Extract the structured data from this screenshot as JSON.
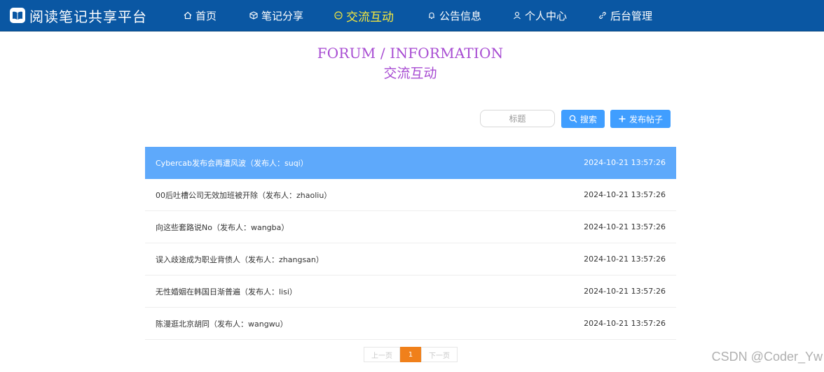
{
  "brand": {
    "title": "阅读笔记共享平台",
    "icon": "book-icon"
  },
  "nav": {
    "home": {
      "label": "首页",
      "icon": "home-icon"
    },
    "notes": {
      "label": "笔记分享",
      "icon": "cube-icon"
    },
    "forum": {
      "label": "交流互动",
      "icon": "chat-icon"
    },
    "notice": {
      "label": "公告信息",
      "icon": "bell-icon"
    },
    "profile": {
      "label": "个人中心",
      "icon": "user-icon"
    },
    "admin": {
      "label": "后台管理",
      "icon": "link-icon"
    }
  },
  "page": {
    "title_en": "FORUM / INFORMATION",
    "title_cn": "交流互动"
  },
  "search": {
    "placeholder": "标题",
    "value": "",
    "button_label": "搜索"
  },
  "publish": {
    "button_label": "发布帖子"
  },
  "posts": [
    {
      "title": "Cybercab发布会再遭风波（发布人：suqi）",
      "date": "2024-10-21 13:57:26"
    },
    {
      "title": "00后吐槽公司无效加班被开除（发布人：zhaoliu）",
      "date": "2024-10-21 13:57:26"
    },
    {
      "title": "向这些套路说No（发布人：wangba）",
      "date": "2024-10-21 13:57:26"
    },
    {
      "title": "误入歧途成为职业背债人（发布人：zhangsan）",
      "date": "2024-10-21 13:57:26"
    },
    {
      "title": "无性婚姻在韩国日渐普遍（发布人：lisi）",
      "date": "2024-10-21 13:57:26"
    },
    {
      "title": "陈漫逛北京胡同（发布人：wangwu）",
      "date": "2024-10-21 13:57:26"
    }
  ],
  "pagination": {
    "prev": "上一页",
    "current": "1",
    "next": "下一页"
  },
  "watermark": "CSDN @Coder_Yw",
  "colors": {
    "nav_bg": "#0a57a3",
    "active": "#f7e93d",
    "accent": "#409eff",
    "title": "#a74bd2",
    "page_active": "#f0801b"
  }
}
